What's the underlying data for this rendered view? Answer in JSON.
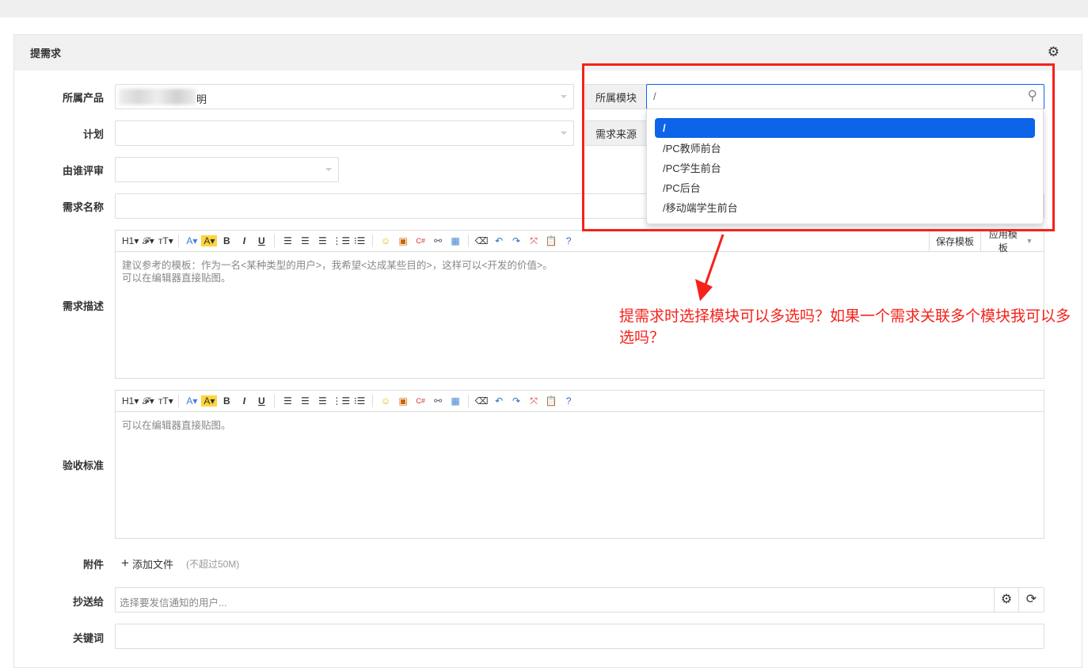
{
  "header": {
    "title": "提需求"
  },
  "form": {
    "product_label": "所属产品",
    "product_value": "明",
    "module_label": "所属模块",
    "module_value": "/",
    "module_options": [
      "/",
      "/PC教师前台",
      "/PC学生前台",
      "/PC后台",
      "/移动端学生前台"
    ],
    "plan_label": "计划",
    "source_label": "需求来源",
    "reviewer_label": "由谁评审",
    "name_label": "需求名称",
    "desc_label": "需求描述",
    "desc_placeholder_1": "建议参考的模板：作为一名<某种类型的用户>，我希望<达成某些目的>，这样可以<开发的价值>。",
    "desc_placeholder_2": "可以在编辑器直接贴图。",
    "save_template": "保存模板",
    "apply_template": "应用模板",
    "verify_label": "验收标准",
    "verify_placeholder": "可以在编辑器直接贴图。",
    "attach_label": "附件",
    "add_file": "添加文件",
    "file_limit": "(不超过50M)",
    "cc_label": "抄送给",
    "cc_placeholder": "选择要发信通知的用户...",
    "keywords_label": "关键词"
  },
  "toolbar": {
    "h1": "H1▾",
    "font": "𝓕▾",
    "size": "тT▾",
    "color": "A▾",
    "bg": "A▾",
    "bold": "B",
    "italic": "I",
    "underline": "U"
  },
  "annotation": {
    "text": "提需求时选择模块可以多选吗？如果一个需求关联多个模块我可以多选吗？"
  },
  "colors": {
    "accent": "#0c64e8",
    "annotation": "#f5221b"
  }
}
